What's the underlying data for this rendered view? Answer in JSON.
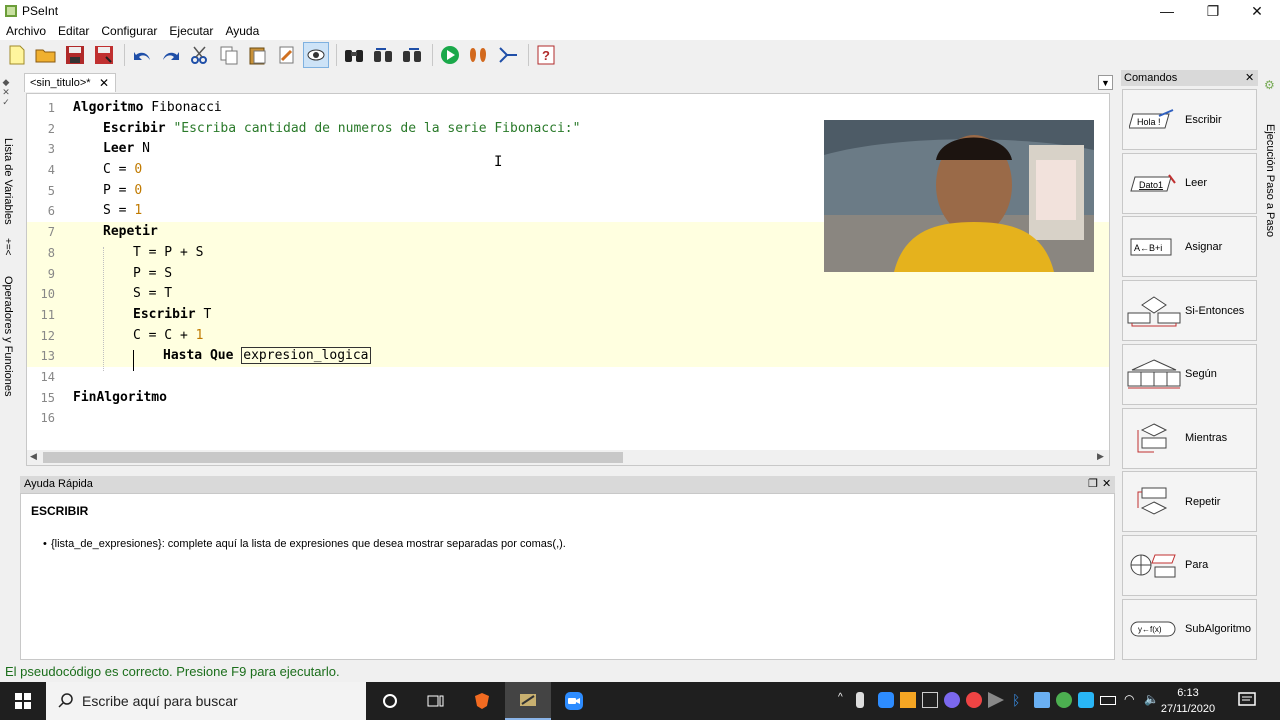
{
  "window": {
    "title": "PSeInt",
    "min_icon": "minimize-icon",
    "max_icon": "restore-icon",
    "close_icon": "close-icon"
  },
  "menu": [
    "Archivo",
    "Editar",
    "Configurar",
    "Ejecutar",
    "Ayuda"
  ],
  "left_tabs": {
    "variables": "Lista de Variables",
    "operators": "Operadores y Funciones"
  },
  "right_tab": "Ejecución Paso a Paso",
  "editor": {
    "tab_label": "<sin_titulo>*",
    "lines": [
      {
        "n": "1",
        "tokens": [
          [
            "kw",
            "Algoritmo"
          ],
          [
            "id",
            " Fibonacci"
          ]
        ],
        "indent": 0
      },
      {
        "n": "2",
        "tokens": [
          [
            "kw",
            "Escribir"
          ],
          [
            "str",
            " \"Escriba cantidad de numeros de la serie Fibonacci:\""
          ]
        ],
        "indent": 1
      },
      {
        "n": "3",
        "tokens": [
          [
            "kw",
            "Leer"
          ],
          [
            "id",
            " N"
          ]
        ],
        "indent": 1
      },
      {
        "n": "4",
        "tokens": [
          [
            "id",
            "C = "
          ],
          [
            "num",
            "0"
          ]
        ],
        "indent": 1
      },
      {
        "n": "5",
        "tokens": [
          [
            "id",
            "P = "
          ],
          [
            "num",
            "0"
          ]
        ],
        "indent": 1
      },
      {
        "n": "6",
        "tokens": [
          [
            "id",
            "S = "
          ],
          [
            "num",
            "1"
          ]
        ],
        "indent": 1
      },
      {
        "n": "7",
        "tokens": [
          [
            "kw",
            "Repetir"
          ]
        ],
        "indent": 1
      },
      {
        "n": "8",
        "tokens": [
          [
            "id",
            "T = P + S"
          ]
        ],
        "indent": 2
      },
      {
        "n": "9",
        "tokens": [
          [
            "id",
            "P = S"
          ]
        ],
        "indent": 2
      },
      {
        "n": "10",
        "tokens": [
          [
            "id",
            "S = T"
          ]
        ],
        "indent": 2
      },
      {
        "n": "11",
        "tokens": [
          [
            "kw",
            "Escribir"
          ],
          [
            "id",
            " T"
          ]
        ],
        "indent": 2
      },
      {
        "n": "12",
        "tokens": [
          [
            "id",
            "C = C + "
          ],
          [
            "num",
            "1"
          ]
        ],
        "indent": 2
      },
      {
        "n": "13",
        "tokens": [
          [
            "kw",
            "Hasta Que"
          ],
          [
            "id",
            " "
          ],
          [
            "box",
            "expresion_logica"
          ]
        ],
        "indent": 3
      },
      {
        "n": "14",
        "tokens": [],
        "indent": 0
      },
      {
        "n": "15",
        "tokens": [
          [
            "kw",
            "FinAlgoritmo"
          ]
        ],
        "indent": 0
      },
      {
        "n": "16",
        "tokens": [],
        "indent": 0
      }
    ]
  },
  "help": {
    "header": "Ayuda Rápida",
    "title": "ESCRIBIR",
    "text": "{lista_de_expresiones}: complete aquí la lista de expresiones que desea mostrar separadas por comas(,)."
  },
  "commands": {
    "header": "Comandos",
    "items": [
      {
        "label": "Escribir",
        "icon_text": "Hola !"
      },
      {
        "label": "Leer",
        "icon_text": "Dato1"
      },
      {
        "label": "Asignar",
        "icon_text": "A←B+i"
      },
      {
        "label": "Si-Entonces",
        "icon_text": ""
      },
      {
        "label": "Según",
        "icon_text": ""
      },
      {
        "label": "Mientras",
        "icon_text": ""
      },
      {
        "label": "Repetir",
        "icon_text": ""
      },
      {
        "label": "Para",
        "icon_text": ""
      },
      {
        "label": "SubAlgoritmo",
        "icon_text": "y←f(x)"
      }
    ]
  },
  "status": "El pseudocódigo es correcto. Presione F9 para ejecutarlo.",
  "taskbar": {
    "search_placeholder": "Escribe aquí para buscar",
    "time": "6:13",
    "date": "27/11/2020"
  }
}
